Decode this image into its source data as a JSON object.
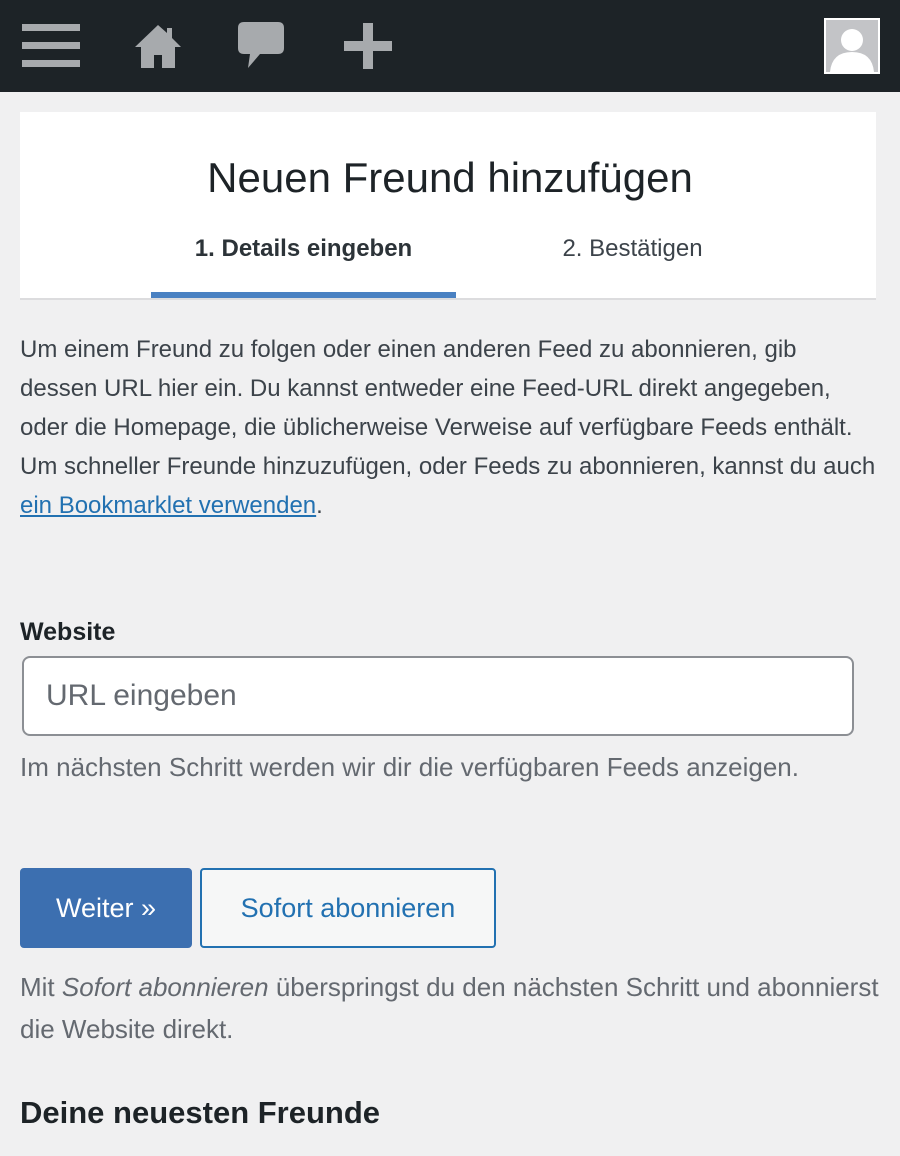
{
  "adminbar": {
    "menu_icon": "hamburger-menu-icon",
    "home_icon": "home-icon",
    "comments_icon": "speech-bubble-icon",
    "new_icon": "plus-icon",
    "avatar_icon": "user-avatar-icon",
    "background_color": "#1d2327"
  },
  "header": {
    "title": "Neuen Freund hinzufügen",
    "tabs": [
      {
        "label": "1. Details eingeben",
        "active": true
      },
      {
        "label": "2. Bestätigen",
        "active": false
      }
    ],
    "accent_color": "#4a81c2"
  },
  "description": {
    "text": "Um einem Freund zu folgen oder einen anderen Feed zu abonnieren, gib dessen URL hier ein. Du kannst entweder eine Feed-URL direkt angegeben, oder die Homepage, die üblicherweise Verweise auf verfügbare Feeds enthält. Um schneller Freunde hinzuzufügen, oder Feeds zu abonnieren, kannst du auch ",
    "link_text": "ein Bookmarklet verwenden",
    "suffix": ".",
    "link_color": "#2271b1"
  },
  "website": {
    "label": "Website",
    "value": "",
    "placeholder": "URL eingeben",
    "hint": "Im nächsten Schritt werden wir dir die verfügbaren Feeds anzeigen."
  },
  "actions": {
    "next_label": "Weiter »",
    "subscribe_label": "Sofort abonnieren",
    "primary_color": "#3c6fb0"
  },
  "note": {
    "prefix": "Mit ",
    "emphasis": "Sofort abonnieren",
    "suffix": " überspringst du den nächsten Schritt und abonnierst die Website direkt."
  },
  "recent": {
    "title": "Deine neuesten Freunde"
  }
}
